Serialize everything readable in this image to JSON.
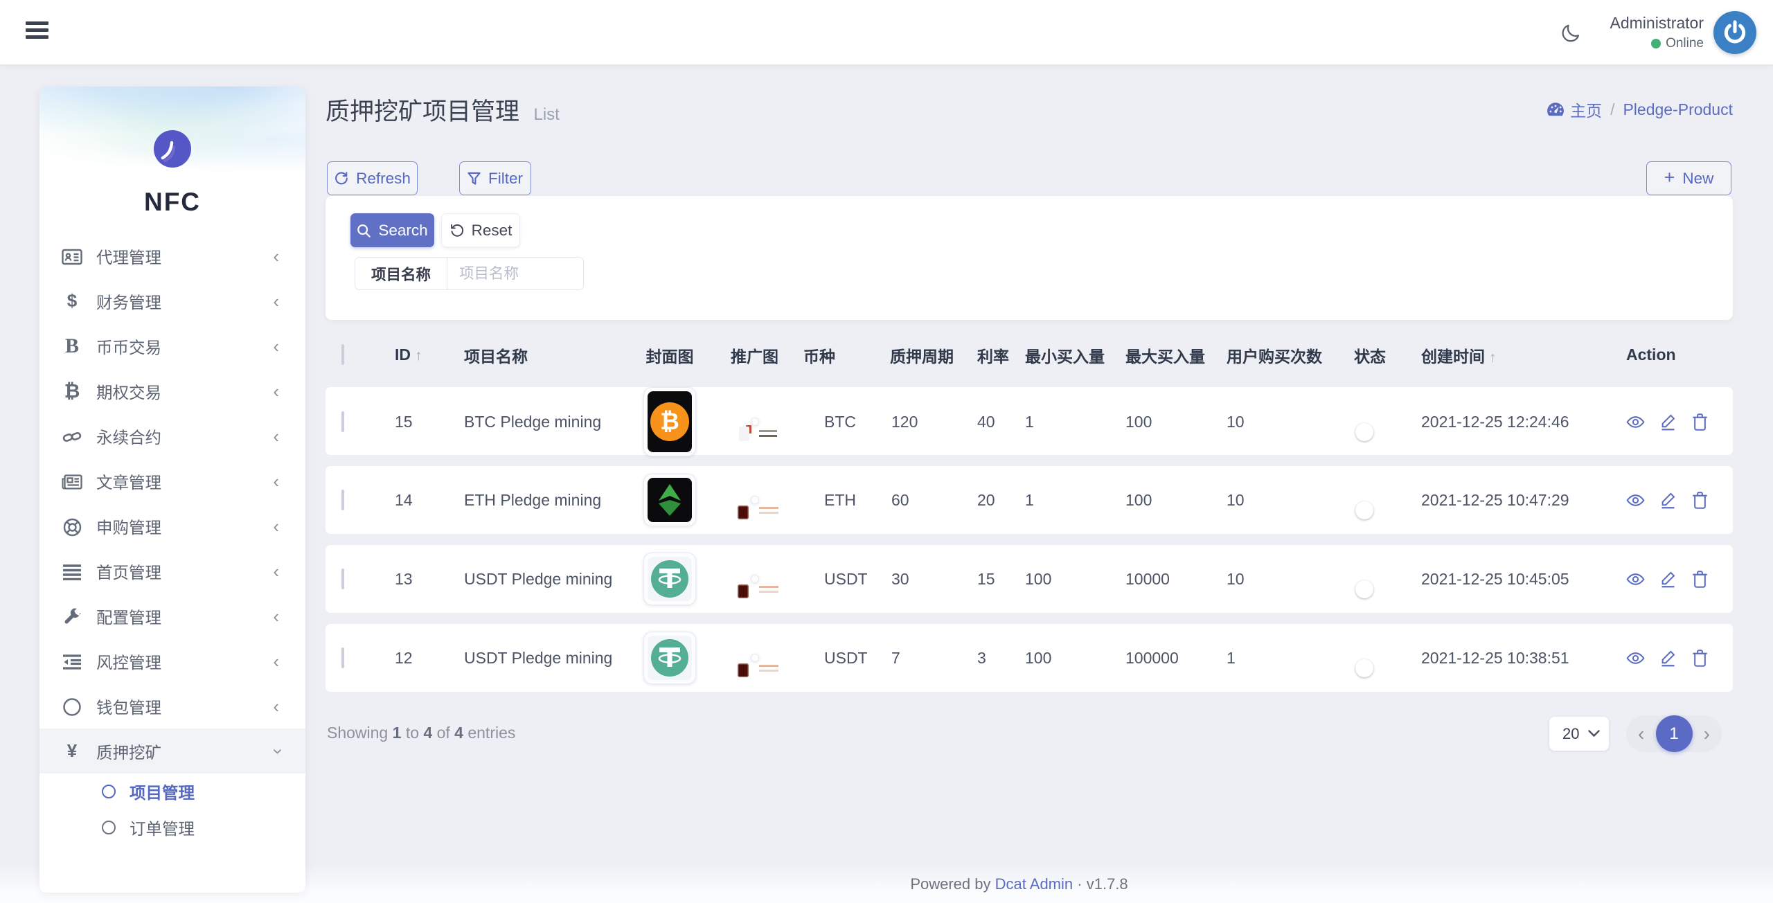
{
  "header": {
    "user_name": "Administrator",
    "status": "Online"
  },
  "sidebar": {
    "logo_text": "NFC",
    "items": [
      {
        "label": "代理管理"
      },
      {
        "label": "财务管理"
      },
      {
        "label": "币币交易"
      },
      {
        "label": "期权交易"
      },
      {
        "label": "永续合约"
      },
      {
        "label": "文章管理"
      },
      {
        "label": "申购管理"
      },
      {
        "label": "首页管理"
      },
      {
        "label": "配置管理"
      },
      {
        "label": "风控管理"
      },
      {
        "label": "钱包管理"
      },
      {
        "label": "质押挖矿"
      }
    ],
    "submenu": [
      {
        "label": "项目管理"
      },
      {
        "label": "订单管理"
      }
    ]
  },
  "page": {
    "title": "质押挖矿项目管理",
    "subtitle": "List",
    "breadcrumb": {
      "home": "主页",
      "sep": "/",
      "current": "Pledge-Product"
    }
  },
  "toolbar": {
    "refresh_label": "Refresh",
    "filter_label": "Filter",
    "new_label": "New"
  },
  "filter_panel": {
    "search_label": "Search",
    "reset_label": "Reset",
    "field_label": "项目名称",
    "placeholder": "项目名称"
  },
  "table": {
    "headers": [
      "ID",
      "项目名称",
      "封面图",
      "推广图",
      "币种",
      "质押周期",
      "利率",
      "最小买入量",
      "最大买入量",
      "用户购买次数",
      "状态",
      "创建时间",
      "Action"
    ],
    "rows": [
      {
        "id": "15",
        "name": "BTC Pledge mining",
        "coin": "BTC",
        "period": "120",
        "rate": "40",
        "min": "1",
        "max": "100",
        "times": "10",
        "created": "2021-12-25 12:24:46"
      },
      {
        "id": "14",
        "name": "ETH Pledge mining",
        "coin": "ETH",
        "period": "60",
        "rate": "20",
        "min": "1",
        "max": "100",
        "times": "10",
        "created": "2021-12-25 10:47:29"
      },
      {
        "id": "13",
        "name": "USDT Pledge mining",
        "coin": "USDT",
        "period": "30",
        "rate": "15",
        "min": "100",
        "max": "10000",
        "times": "10",
        "created": "2021-12-25 10:45:05"
      },
      {
        "id": "12",
        "name": "USDT Pledge mining",
        "coin": "USDT",
        "period": "7",
        "rate": "3",
        "min": "100",
        "max": "100000",
        "times": "1",
        "created": "2021-12-25 10:38:51"
      }
    ]
  },
  "pagination": {
    "showing_word": "Showing",
    "from": "1",
    "to_word": "to",
    "to": "4",
    "of_word": "of",
    "total": "4",
    "entries_word": "entries",
    "page_size": "20",
    "current_page": "1"
  },
  "footer": {
    "powered_by": "Powered by",
    "link": "Dcat Admin",
    "sep": "·",
    "version": "v1.7.8"
  },
  "icons": {
    "dollar": "$",
    "letter_b": "B",
    "bitcoin": "₿",
    "yen": "¥",
    "chevron_left": "‹",
    "chevron_right": "›",
    "arrow_up": "↑",
    "plus": "+"
  },
  "colors": {
    "accent": "#5b6ac5",
    "link": "#5b6bbf",
    "online": "#43b077",
    "avatar_bg": "#3b80c4",
    "btc": "#f7931a",
    "usdt": "#53ae94"
  }
}
